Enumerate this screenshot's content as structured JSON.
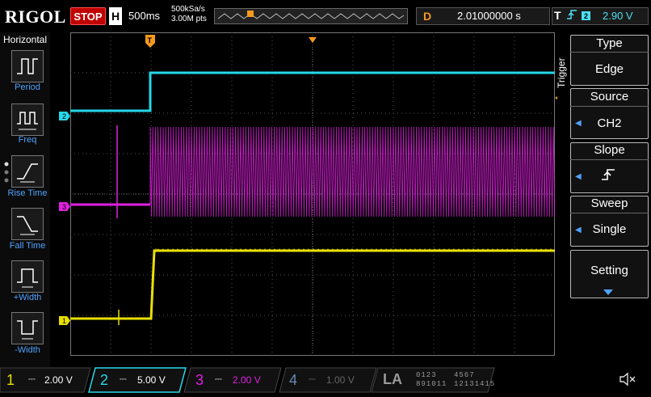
{
  "header": {
    "logo": "RIGOL",
    "run_state": "STOP",
    "timebase_label": "H",
    "timebase_value": "500ms",
    "sample_rate": "500kSa/s",
    "memory_depth": "3.00M pts",
    "delay_label": "D",
    "delay_value": "2.01000000 s",
    "trigger_label": "T",
    "trigger_edge_icon": "rising-edge-icon",
    "trigger_source": "2",
    "trigger_level": "2.90 V"
  },
  "measure_menu": {
    "title": "Horizontal",
    "items": [
      {
        "label": "Period",
        "icon": "period-icon"
      },
      {
        "label": "Freq",
        "icon": "frequency-icon"
      },
      {
        "label": "Rise Time",
        "icon": "rise-time-icon"
      },
      {
        "label": "Fall Time",
        "icon": "fall-time-icon"
      },
      {
        "label": "+Width",
        "icon": "positive-width-icon"
      },
      {
        "label": "-Width",
        "icon": "negative-width-icon"
      }
    ]
  },
  "trigger_menu": {
    "title": "Trigger",
    "items": [
      {
        "header": "Type",
        "value": "Edge"
      },
      {
        "header": "Source",
        "value": "CH2"
      },
      {
        "header": "Slope",
        "value": "rising-edge-icon"
      },
      {
        "header": "Sweep",
        "value": "Single"
      }
    ],
    "setting_label": "Setting"
  },
  "channels": [
    {
      "num": "1",
      "scale": "2.00 V",
      "color": "#e8e000",
      "active": true
    },
    {
      "num": "2",
      "scale": "5.00 V",
      "color": "#25d8e8",
      "active": true
    },
    {
      "num": "3",
      "scale": "2.00 V",
      "color": "#e020e0",
      "active": true
    },
    {
      "num": "4",
      "scale": "1.00 V",
      "color": "#3f7fbf",
      "active": false
    }
  ],
  "logic_analyzer": {
    "label": "LA",
    "groups": [
      "0123",
      "4567",
      "891011",
      "12131415"
    ]
  },
  "waveform_markers": {
    "ch1": "1",
    "ch2": "2",
    "ch3": "3",
    "trigger_pos": "T"
  },
  "colors": {
    "ch1": "#e8e000",
    "ch2": "#25d8e8",
    "ch3": "#e020e0",
    "ch4": "#3f7fbf",
    "trigger": "#f39a1e",
    "accent": "#4fa3ff"
  }
}
